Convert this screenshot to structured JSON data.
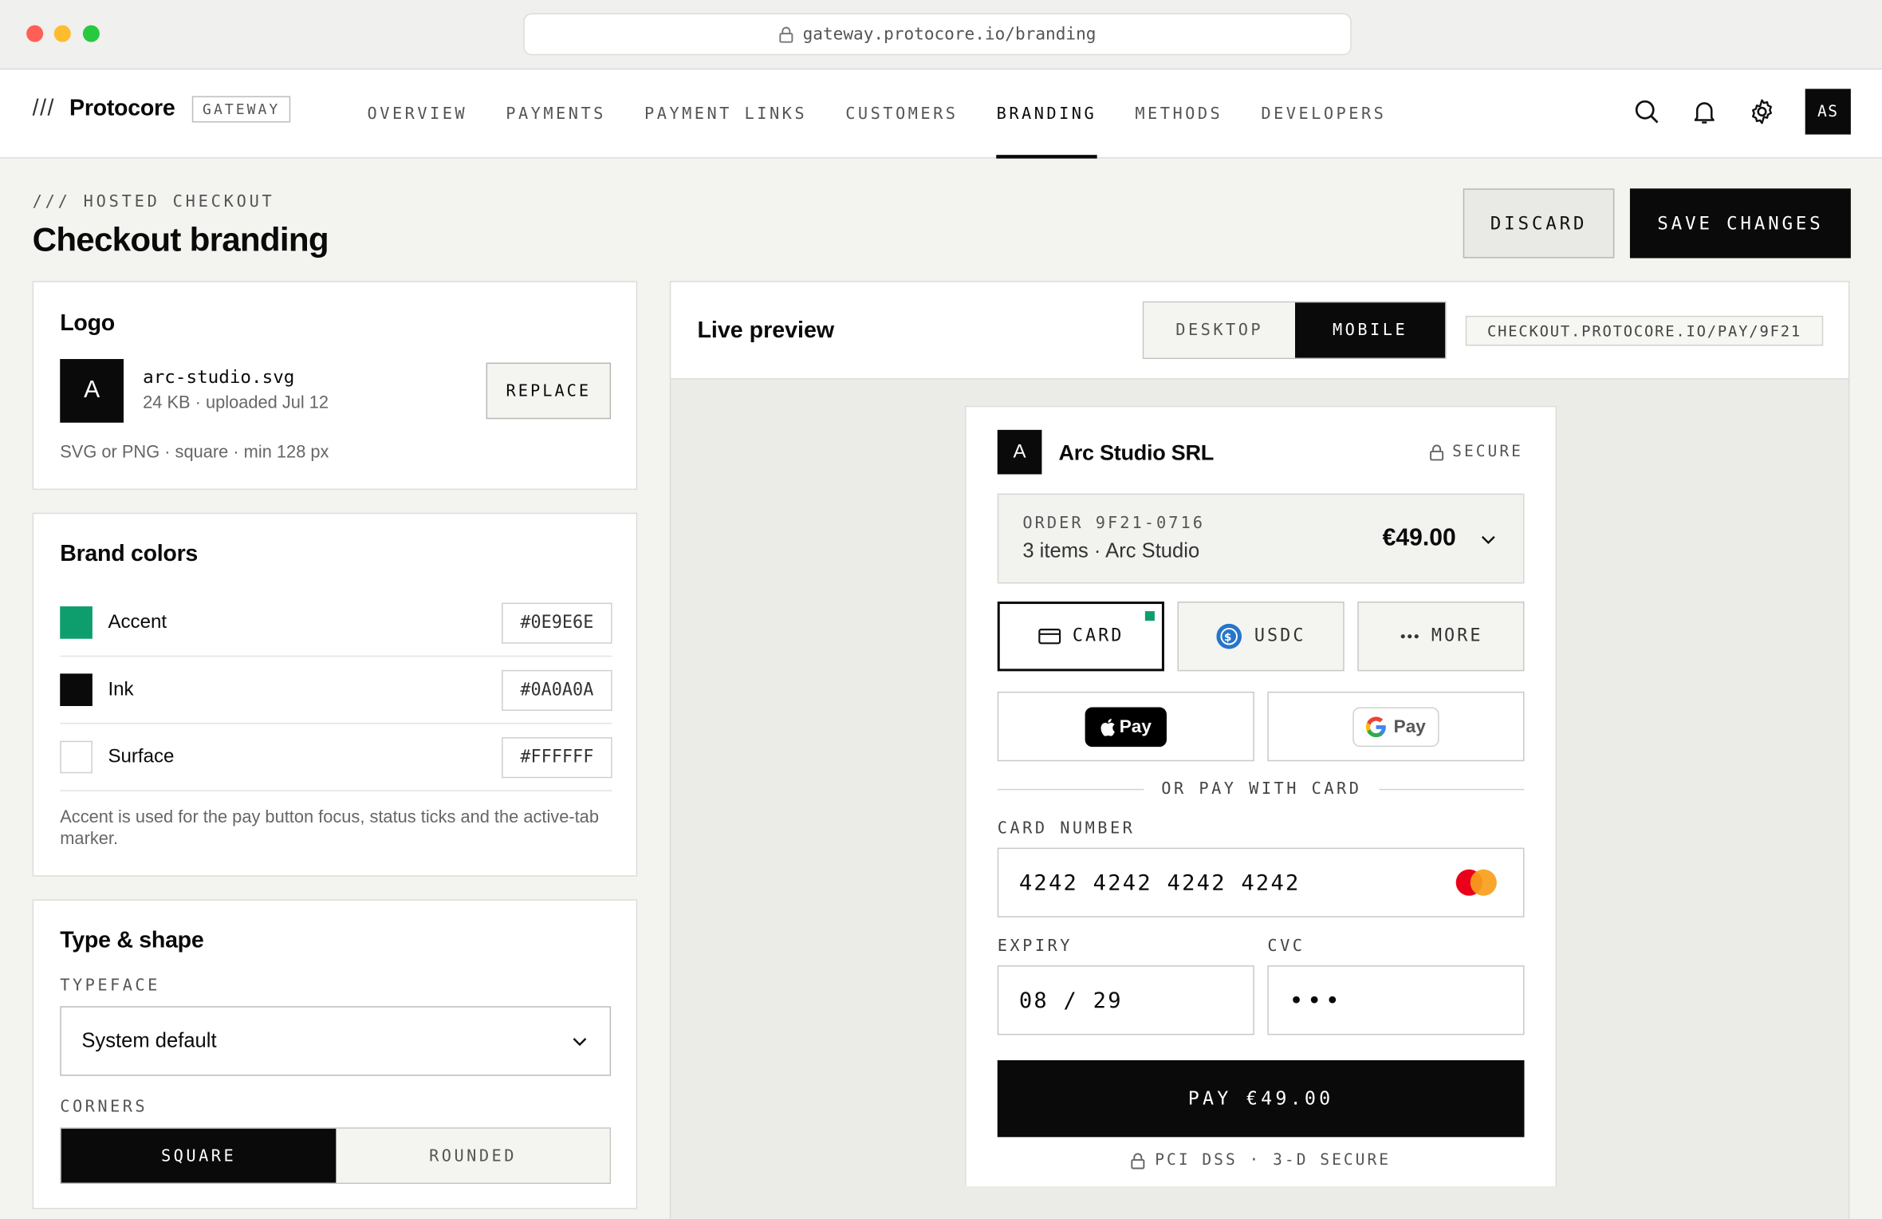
{
  "browser": {
    "url": "gateway.protocore.io/branding"
  },
  "nav": {
    "slashes": "///",
    "brand": "Protocore",
    "product_tag": "GATEWAY",
    "items": [
      "OVERVIEW",
      "PAYMENTS",
      "PAYMENT LINKS",
      "CUSTOMERS",
      "BRANDING",
      "METHODS",
      "DEVELOPERS"
    ],
    "active": "BRANDING",
    "avatar_initials": "AS"
  },
  "header": {
    "eyebrow": "/// HOSTED CHECKOUT",
    "title": "Checkout branding",
    "discard_label": "DISCARD",
    "save_label": "SAVE CHANGES"
  },
  "logo_card": {
    "title": "Logo",
    "tile_letter": "A",
    "filename": "arc-studio.svg",
    "meta": "24 KB · uploaded Jul 12",
    "replace_label": "REPLACE",
    "hint": "SVG or PNG · square · min 128 px"
  },
  "brand_colors": {
    "title": "Brand colors",
    "rows": [
      {
        "name": "Accent",
        "hex": "#0E9E6E",
        "color": "#0E9E6E"
      },
      {
        "name": "Ink",
        "hex": "#0A0A0A",
        "color": "#0A0A0A"
      },
      {
        "name": "Surface",
        "hex": "#FFFFFF",
        "color": "#FFFFFF"
      }
    ],
    "note": "Accent is used for the pay button focus, status ticks and the active-tab marker."
  },
  "type_shape": {
    "title": "Type & shape",
    "typeface_label": "TYPEFACE",
    "typeface_value": "System default",
    "corners_label": "CORNERS",
    "corner_options": [
      "SQUARE",
      "ROUNDED"
    ],
    "corner_selected": "SQUARE"
  },
  "preview": {
    "title": "Live preview",
    "modes": [
      "DESKTOP",
      "MOBILE"
    ],
    "mode_selected": "MOBILE",
    "url_chip": "CHECKOUT.PROTOCORE.IO/PAY/9F21",
    "checkout": {
      "merchant_letter": "A",
      "merchant": "Arc Studio SRL",
      "secure": "SECURE",
      "order_label": "ORDER 9F21-0716",
      "order_summary": "3 items · Arc Studio",
      "amount": "€49.00",
      "methods": [
        "CARD",
        "USDC",
        "MORE"
      ],
      "method_selected": "CARD",
      "apple_pay": "Pay",
      "google_pay": "Pay",
      "divider": "OR PAY WITH CARD",
      "card_number_label": "CARD NUMBER",
      "card_number": "4242 4242 4242 4242",
      "expiry_label": "EXPIRY",
      "expiry": "08 / 29",
      "cvc_label": "CVC",
      "cvc": "•••",
      "pay_label": "PAY €49.00",
      "footer": "PCI DSS · 3-D SECURE"
    }
  },
  "colors": {
    "accent": "#0E9E6E",
    "ink": "#0A0A0A",
    "usdc": "#2775CA",
    "mc_red": "#EB001B",
    "mc_orange": "#F79E1B"
  }
}
